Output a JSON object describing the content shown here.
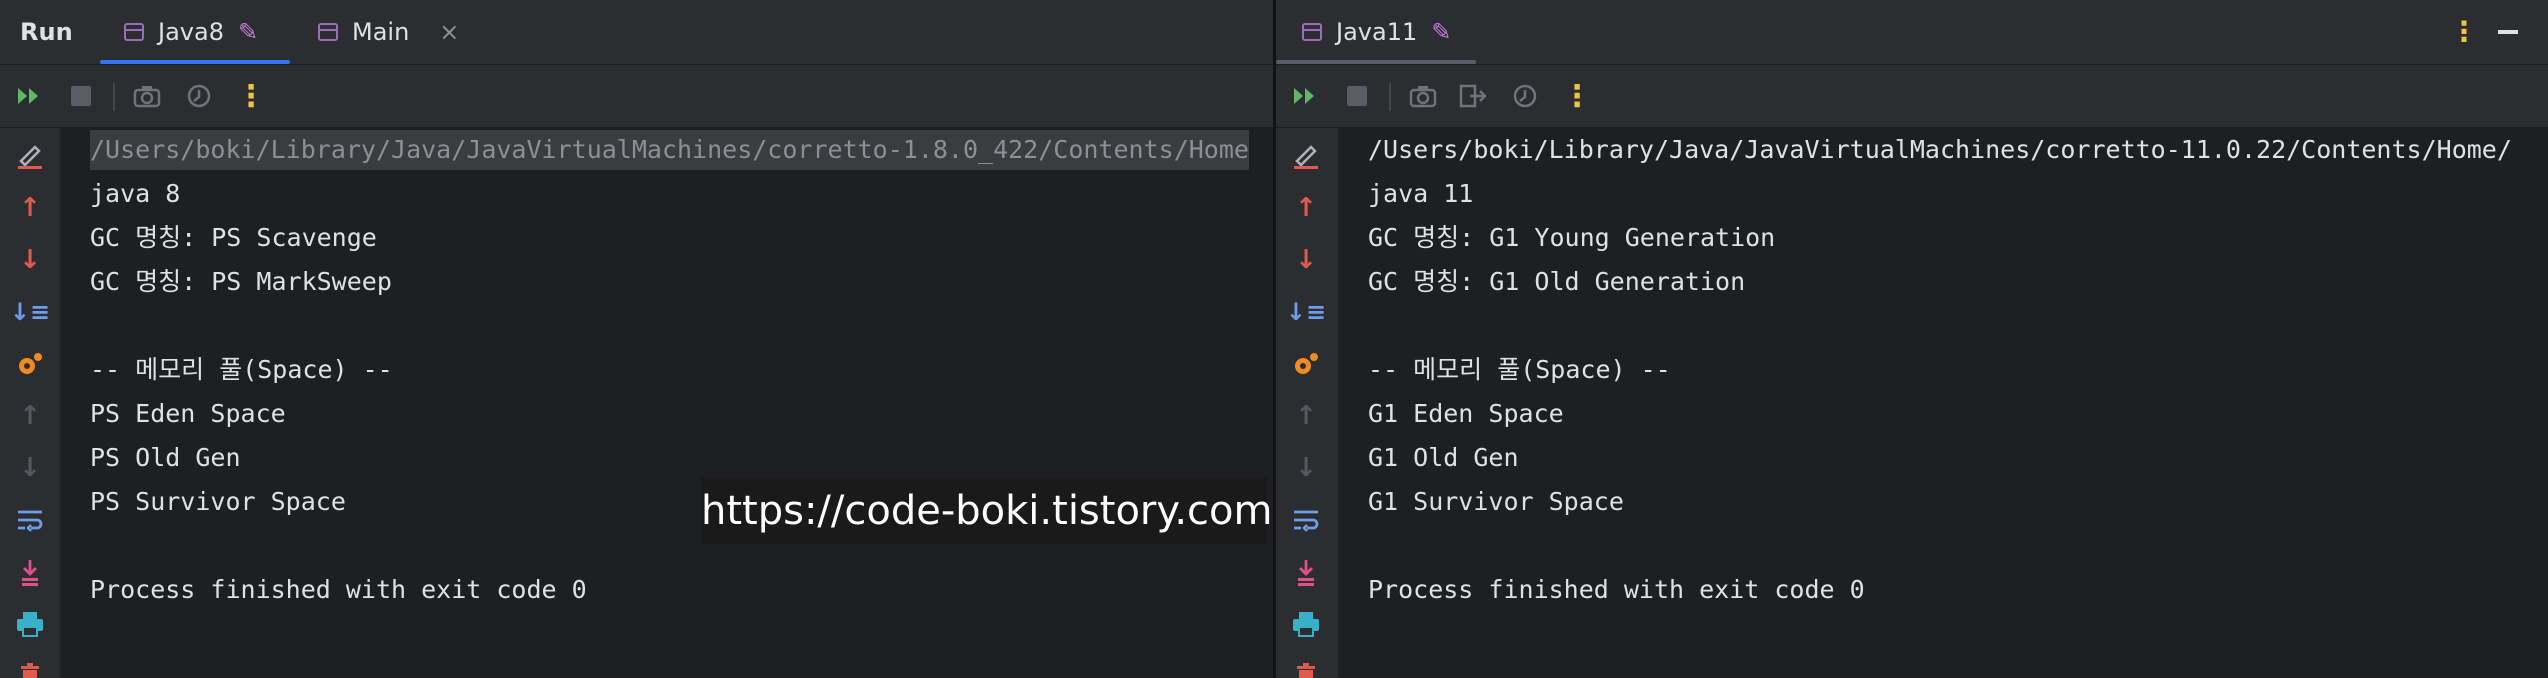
{
  "left": {
    "title": "Run",
    "tabs": [
      {
        "label": "Java8",
        "active": true,
        "pinned": true
      },
      {
        "label": "Main",
        "active": false,
        "closable": true
      }
    ],
    "console": {
      "command": "/Users/boki/Library/Java/JavaVirtualMachines/corretto-1.8.0_422/Contents/Home",
      "lines": [
        "java 8",
        "GC 명칭: PS Scavenge",
        "GC 명칭: PS MarkSweep",
        "",
        "-- 메모리 풀(Space) --",
        "PS Eden Space",
        "PS Old Gen",
        "PS Survivor Space",
        "",
        "Process finished with exit code 0"
      ]
    }
  },
  "right": {
    "tabs": [
      {
        "label": "Java11",
        "active": true,
        "pinned": true
      }
    ],
    "console": {
      "command": "/Users/boki/Library/Java/JavaVirtualMachines/corretto-11.0.22/Contents/Home/",
      "lines": [
        "java 11",
        "GC 명칭: G1 Young Generation",
        "GC 명칭: G1 Old Generation",
        "",
        "-- 메모리 풀(Space) --",
        "G1 Eden Space",
        "G1 Old Gen",
        "G1 Survivor Space",
        "",
        "Process finished with exit code 0"
      ]
    }
  },
  "watermark": "https://code-boki.tistory.com",
  "icons": {
    "rerun": "rerun-icon",
    "stop": "stop-icon",
    "screenshot": "camera-icon",
    "exit": "exit-icon",
    "dump": "dump-threads-icon",
    "more": "more-vertical-icon",
    "clear": "clear-all-icon",
    "up": "arrow-up-icon",
    "down": "arrow-down-icon",
    "sort": "sort-icon",
    "hotswap": "hotswap-icon",
    "prev": "previous-occurrence-icon",
    "next": "next-occurrence-icon",
    "wrap": "soft-wrap-icon",
    "scroll": "scroll-to-end-icon",
    "print": "print-icon",
    "delete": "delete-icon"
  },
  "colors": {
    "accent_blue": "#3574f0",
    "run_green": "#5fb865",
    "red": "#e05a4f",
    "orange": "#f08a24",
    "yellow": "#f0c43b",
    "purple": "#9b6dbd",
    "pink": "#e0508a",
    "teal": "#3ab0c8"
  }
}
